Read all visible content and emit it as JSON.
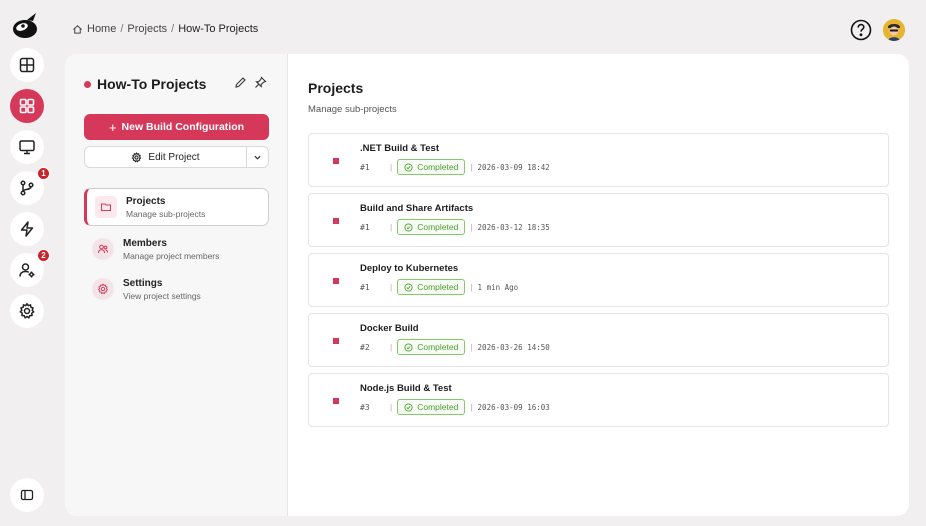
{
  "breadcrumb": {
    "home": "Home",
    "projects": "Projects",
    "current": "How-To Projects",
    "separator": "/"
  },
  "rail": {
    "items": [
      {
        "icon": "layout-icon"
      },
      {
        "icon": "dashboard-icon",
        "active": true
      },
      {
        "icon": "monitor-icon"
      },
      {
        "icon": "git-branch-icon",
        "badge": "1"
      },
      {
        "icon": "lightning-icon"
      },
      {
        "icon": "user-settings-icon",
        "badge": "2"
      },
      {
        "icon": "gear-icon"
      }
    ],
    "accent": "#d6385a"
  },
  "sidebar": {
    "project_title": "How-To Projects",
    "new_build_label": "New Build Configuration",
    "new_build_prefix": "+",
    "edit_project_label": "Edit Project",
    "nav": [
      {
        "title": "Projects",
        "subtitle": "Manage sub-projects",
        "icon": "folder-icon",
        "active": true
      },
      {
        "title": "Members",
        "subtitle": "Manage project members",
        "icon": "members-icon"
      },
      {
        "title": "Settings",
        "subtitle": "View project settings",
        "icon": "gear-icon"
      }
    ]
  },
  "content": {
    "title": "Projects",
    "subtitle": "Manage sub-projects",
    "status_color": "#4f9d34",
    "rows": [
      {
        "name": ".NET Build & Test",
        "number": "#1",
        "status": "Completed",
        "time": "2026-03-09 18:42"
      },
      {
        "name": "Build and Share Artifacts",
        "number": "#1",
        "status": "Completed",
        "time": "2026-03-12 18:35"
      },
      {
        "name": "Deploy to Kubernetes",
        "number": "#1",
        "status": "Completed",
        "time": "1 min Ago"
      },
      {
        "name": "Docker Build",
        "number": "#2",
        "status": "Completed",
        "time": "2026-03-26 14:50"
      },
      {
        "name": "Node.js Build & Test",
        "number": "#3",
        "status": "Completed",
        "time": "2026-03-09 16:03"
      }
    ]
  }
}
